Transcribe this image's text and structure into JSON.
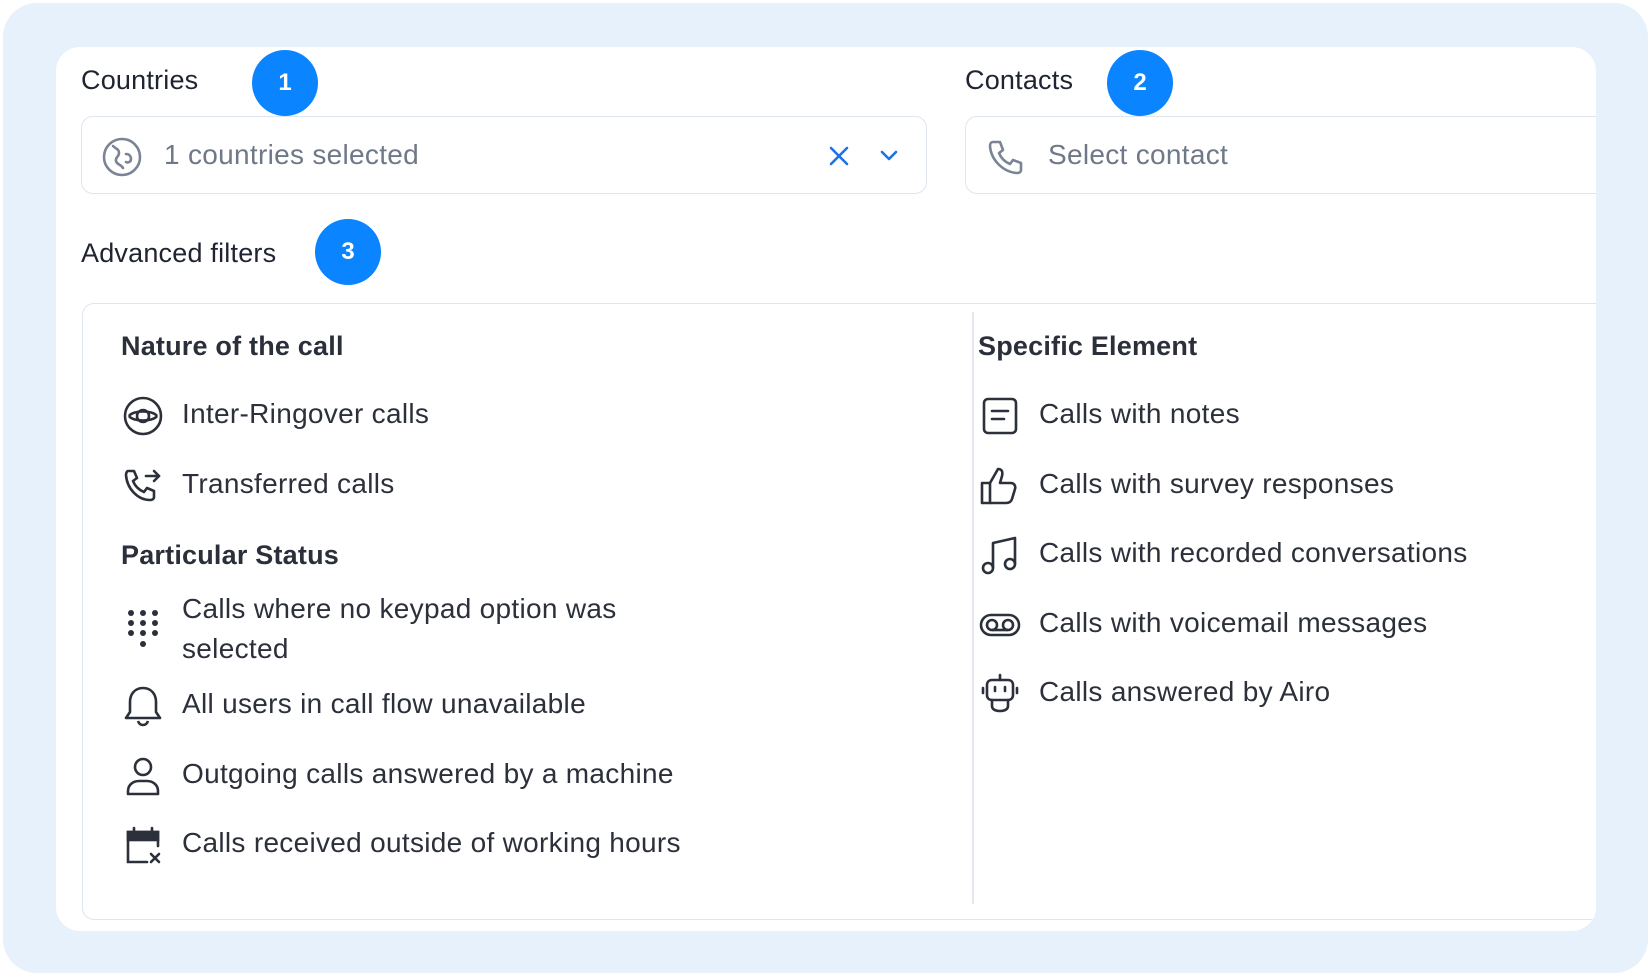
{
  "countries": {
    "label": "Countries",
    "badge": "1",
    "value": "1 countries selected",
    "clear_icon": "close-icon",
    "dropdown_icon": "chevron-down-icon",
    "field_icon": "globe-icon"
  },
  "contacts": {
    "label": "Contacts",
    "badge": "2",
    "placeholder": "Select contact",
    "field_icon": "phone-icon"
  },
  "advanced": {
    "label": "Advanced filters",
    "badge": "3",
    "nature": {
      "title": "Nature of the call",
      "items": [
        {
          "label": "Inter-Ringover calls",
          "icon": "ringover-icon"
        },
        {
          "label": "Transferred calls",
          "icon": "phone-forward-icon"
        }
      ]
    },
    "status": {
      "title": "Particular Status",
      "items": [
        {
          "label": "Calls where no keypad option was selected",
          "icon": "keypad-icon"
        },
        {
          "label": "All users in call flow unavailable",
          "icon": "bell-icon"
        },
        {
          "label": "Outgoing calls answered by a machine",
          "icon": "user-icon"
        },
        {
          "label": "Calls received outside of working hours",
          "icon": "calendar-x-icon"
        }
      ]
    },
    "specific": {
      "title": "Specific Element",
      "items": [
        {
          "label": "Calls with notes",
          "icon": "note-icon"
        },
        {
          "label": "Calls with survey responses",
          "icon": "thumbs-up-icon"
        },
        {
          "label": "Calls with recorded conversations",
          "icon": "music-note-icon"
        },
        {
          "label": "Calls with voicemail messages",
          "icon": "voicemail-icon"
        },
        {
          "label": "Calls answered by Airo",
          "icon": "robot-icon"
        }
      ]
    }
  },
  "colors": {
    "background": "#e6f1fc",
    "badge": "#0a84ff",
    "accent": "#1a73e8"
  }
}
